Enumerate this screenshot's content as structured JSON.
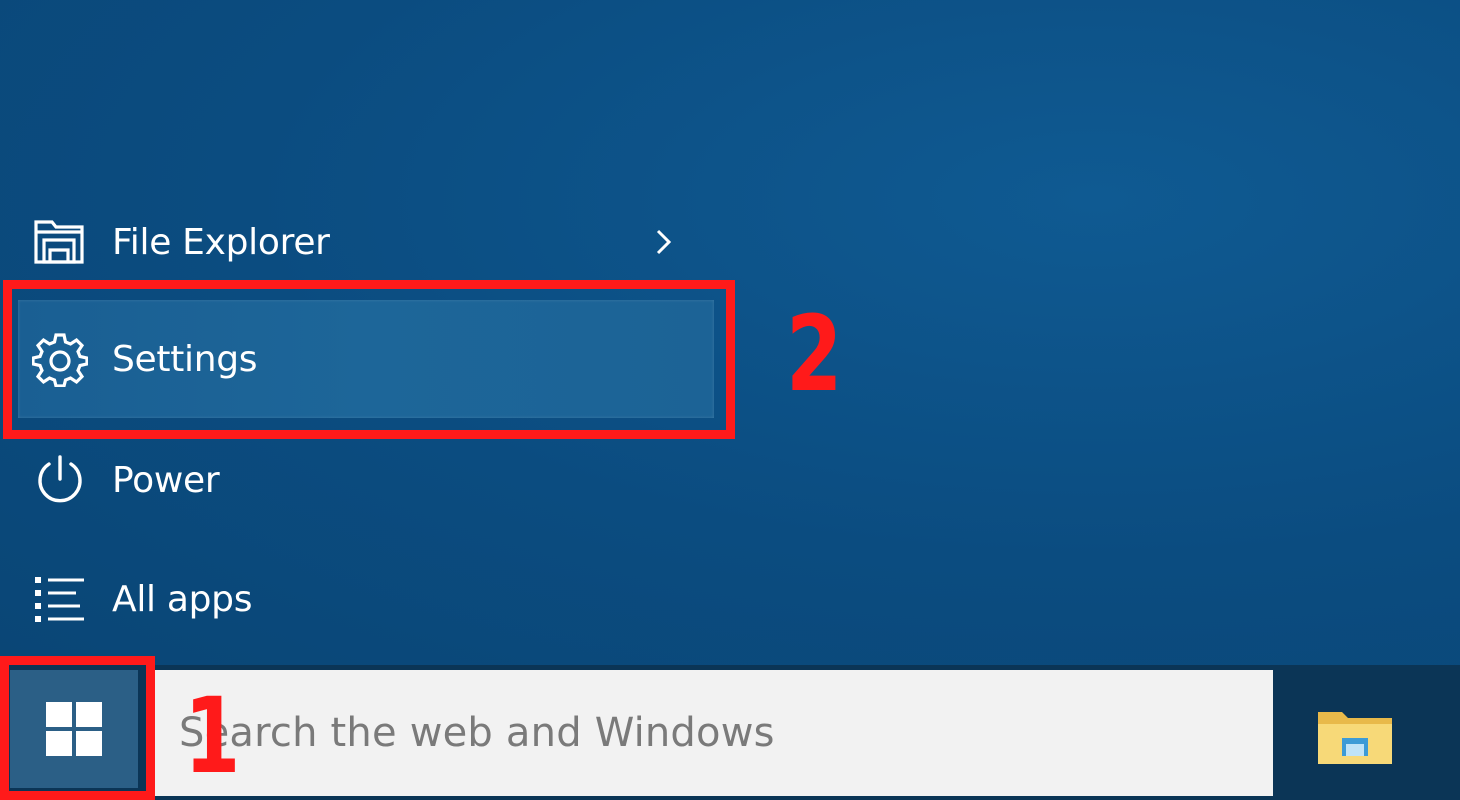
{
  "start_menu": {
    "items": [
      {
        "label": "File Explorer",
        "icon": "file-explorer-icon",
        "has_submenu": true
      },
      {
        "label": "Settings",
        "icon": "gear-icon",
        "highlighted": true
      },
      {
        "label": "Power",
        "icon": "power-icon"
      },
      {
        "label": "All apps",
        "icon": "all-apps-icon"
      }
    ]
  },
  "annotations": {
    "step_1": "1",
    "step_2": "2",
    "color": "#ff1a1a"
  },
  "taskbar": {
    "start_icon": "windows-logo-icon",
    "search_placeholder": "Search the web and Windows",
    "pinned": [
      {
        "icon": "folder-icon",
        "app": "File Explorer"
      }
    ]
  }
}
